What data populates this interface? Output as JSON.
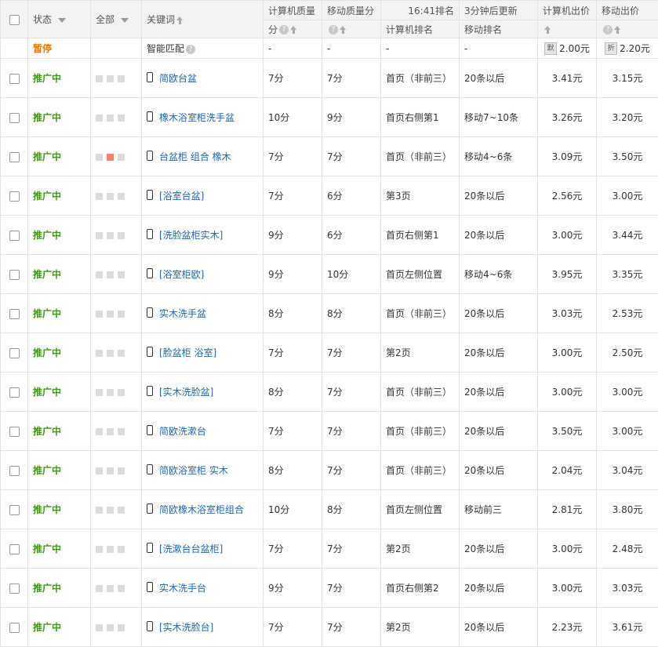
{
  "header": {
    "status": "状态",
    "all": "全部",
    "keyword": "关键词",
    "pc_quality": "计算机质量",
    "pc_quality_unit": "分",
    "mobile_quality": "移动质量分",
    "time_rank": "16:41排名",
    "update": "3分钟后更新",
    "pc_rank": "计算机排名",
    "mobile_rank": "移动排名",
    "pc_bid": "计算机出价",
    "mobile_bid": "移动出价"
  },
  "summary": {
    "status": "暂停",
    "keyword": "智能匹配",
    "pc_quality": "-",
    "mobile_quality": "-",
    "pc_rank": "-",
    "mobile_rank": "-",
    "pc_tag": "默",
    "pc_bid": "2.00元",
    "mobile_tag": "折",
    "mobile_bid": "2.20元"
  },
  "rows": [
    {
      "status": "推广中",
      "kw": "简欧台盆",
      "pcq": "7分",
      "mq": "7分",
      "pcr": "首页（非前三）",
      "mr": "20条以后",
      "pcb": "3.41元",
      "mb": "3.15元"
    },
    {
      "status": "推广中",
      "kw": "橡木浴室柜洗手盆",
      "pcq": "10分",
      "mq": "9分",
      "pcr": "首页右侧第1",
      "mr": "移动7~10条",
      "pcb": "3.26元",
      "mb": "3.20元"
    },
    {
      "status": "推广中",
      "kw": "台盆柜 组合 橡木",
      "pcq": "7分",
      "mq": "7分",
      "pcr": "首页（非前三）",
      "mr": "移动4~6条",
      "pcb": "3.09元",
      "mb": "3.50元"
    },
    {
      "status": "推广中",
      "kw": "[浴室台盆]",
      "pcq": "7分",
      "mq": "6分",
      "pcr": "第3页",
      "mr": "20条以后",
      "pcb": "2.56元",
      "mb": "3.00元"
    },
    {
      "status": "推广中",
      "kw": "[洗脸盆柜实木]",
      "pcq": "9分",
      "mq": "6分",
      "pcr": "首页右侧第1",
      "mr": "20条以后",
      "pcb": "3.00元",
      "mb": "3.44元"
    },
    {
      "status": "推广中",
      "kw": "[浴室柜欧]",
      "pcq": "9分",
      "mq": "10分",
      "pcr": "首页左侧位置",
      "mr": "移动4~6条",
      "pcb": "3.95元",
      "mb": "3.35元"
    },
    {
      "status": "推广中",
      "kw": "实木洗手盆",
      "pcq": "8分",
      "mq": "8分",
      "pcr": "首页（非前三）",
      "mr": "20条以后",
      "pcb": "3.03元",
      "mb": "2.53元"
    },
    {
      "status": "推广中",
      "kw": "[脸盆柜 浴室]",
      "pcq": "7分",
      "mq": "7分",
      "pcr": "第2页",
      "mr": "20条以后",
      "pcb": "3.00元",
      "mb": "2.50元"
    },
    {
      "status": "推广中",
      "kw": "[实木洗脸盆]",
      "pcq": "8分",
      "mq": "7分",
      "pcr": "首页（非前三）",
      "mr": "20条以后",
      "pcb": "3.00元",
      "mb": "3.00元"
    },
    {
      "status": "推广中",
      "kw": "简欧洗漱台",
      "pcq": "7分",
      "mq": "7分",
      "pcr": "首页（非前三）",
      "mr": "20条以后",
      "pcb": "3.50元",
      "mb": "3.00元"
    },
    {
      "status": "推广中",
      "kw": "简欧浴室柜 实木",
      "pcq": "8分",
      "mq": "7分",
      "pcr": "首页（非前三）",
      "mr": "20条以后",
      "pcb": "2.04元",
      "mb": "3.04元"
    },
    {
      "status": "推广中",
      "kw": "简欧橡木浴室柜组合",
      "pcq": "10分",
      "mq": "8分",
      "pcr": "首页左侧位置",
      "mr": "移动前三",
      "pcb": "2.81元",
      "mb": "3.80元"
    },
    {
      "status": "推广中",
      "kw": "[洗漱台台盆柜]",
      "pcq": "7分",
      "mq": "7分",
      "pcr": "第2页",
      "mr": "20条以后",
      "pcb": "3.00元",
      "mb": "2.48元"
    },
    {
      "status": "推广中",
      "kw": "实木洗手台",
      "pcq": "9分",
      "mq": "7分",
      "pcr": "首页右侧第2",
      "mr": "20条以后",
      "pcb": "3.00元",
      "mb": "3.03元"
    },
    {
      "status": "推广中",
      "kw": "[实木洗脸台]",
      "pcq": "7分",
      "mq": "7分",
      "pcr": "第2页",
      "mr": "20条以后",
      "pcb": "2.23元",
      "mb": "3.61元"
    }
  ]
}
